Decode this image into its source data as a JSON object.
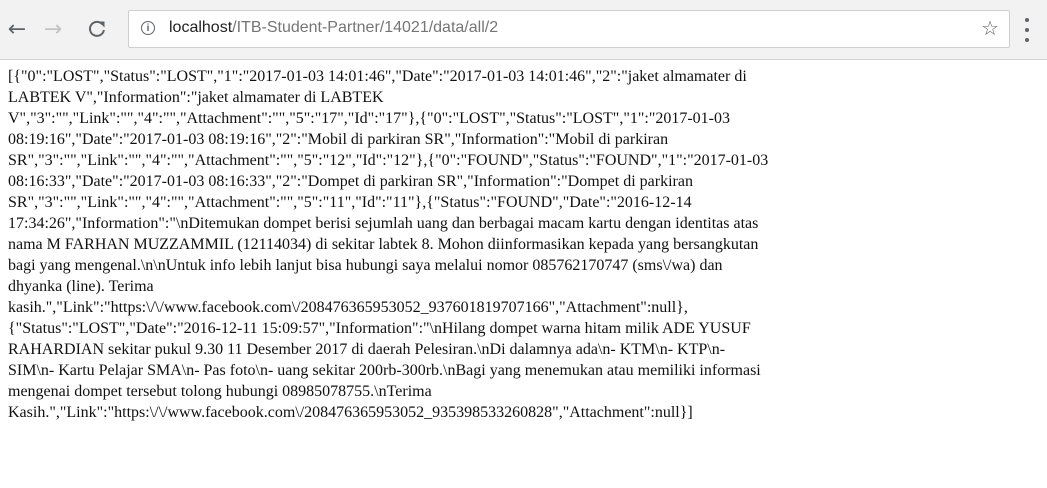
{
  "browser": {
    "url_host": "localhost",
    "url_path": "/ITB-Student-Partner/14021/data/all/2",
    "icons": {
      "back": "back-arrow-icon",
      "forward": "forward-arrow-icon",
      "reload": "reload-icon",
      "info": "info-icon",
      "bookmark": "star-icon",
      "menu": "kebab-menu-icon"
    }
  },
  "response_lines": [
    "[{\"0\":\"LOST\",\"Status\":\"LOST\",\"1\":\"2017-01-03 14:01:46\",\"Date\":\"2017-01-03 14:01:46\",\"2\":\"jaket almamater di",
    "LABTEK V\",\"Information\":\"jaket almamater di LABTEK",
    "V\",\"3\":\"\",\"Link\":\"\",\"4\":\"\",\"Attachment\":\"\",\"5\":\"17\",\"Id\":\"17\"},{\"0\":\"LOST\",\"Status\":\"LOST\",\"1\":\"2017-01-03",
    "08:19:16\",\"Date\":\"2017-01-03 08:19:16\",\"2\":\"Mobil di parkiran SR\",\"Information\":\"Mobil di parkiran",
    "SR\",\"3\":\"\",\"Link\":\"\",\"4\":\"\",\"Attachment\":\"\",\"5\":\"12\",\"Id\":\"12\"},{\"0\":\"FOUND\",\"Status\":\"FOUND\",\"1\":\"2017-01-03",
    "08:16:33\",\"Date\":\"2017-01-03 08:16:33\",\"2\":\"Dompet di parkiran SR\",\"Information\":\"Dompet di parkiran",
    "SR\",\"3\":\"\",\"Link\":\"\",\"4\":\"\",\"Attachment\":\"\",\"5\":\"11\",\"Id\":\"11\"},{\"Status\":\"FOUND\",\"Date\":\"2016-12-14",
    "17:34:26\",\"Information\":\"\\nDitemukan dompet berisi sejumlah uang dan berbagai macam kartu dengan identitas atas",
    "nama M FARHAN MUZZAMMIL (12114034) di sekitar labtek 8. Mohon diinformasikan kepada yang bersangkutan",
    "bagi yang mengenal.\\n\\nUntuk info lebih lanjut bisa hubungi saya melalui nomor 085762170747 (sms\\/wa) dan",
    "dhyanka (line). Terima",
    "kasih.\",\"Link\":\"https:\\/\\/www.facebook.com\\/208476365953052_937601819707166\",\"Attachment\":null},",
    "{\"Status\":\"LOST\",\"Date\":\"2016-12-11 15:09:57\",\"Information\":\"\\nHilang dompet warna hitam milik ADE YUSUF",
    "RAHARDIAN sekitar pukul 9.30 11 Desember 2017 di daerah Pelesiran.\\nDi dalamnya ada\\n- KTM\\n- KTP\\n-",
    "SIM\\n- Kartu Pelajar SMA\\n- Pas foto\\n- uang sekitar 200rb-300rb.\\nBagi yang menemukan atau memiliki informasi",
    "mengenai dompet tersebut tolong hubungi 08985078755.\\nTerima",
    "Kasih.\",\"Link\":\"https:\\/\\/www.facebook.com\\/208476365953052_935398533260828\",\"Attachment\":null}]"
  ]
}
